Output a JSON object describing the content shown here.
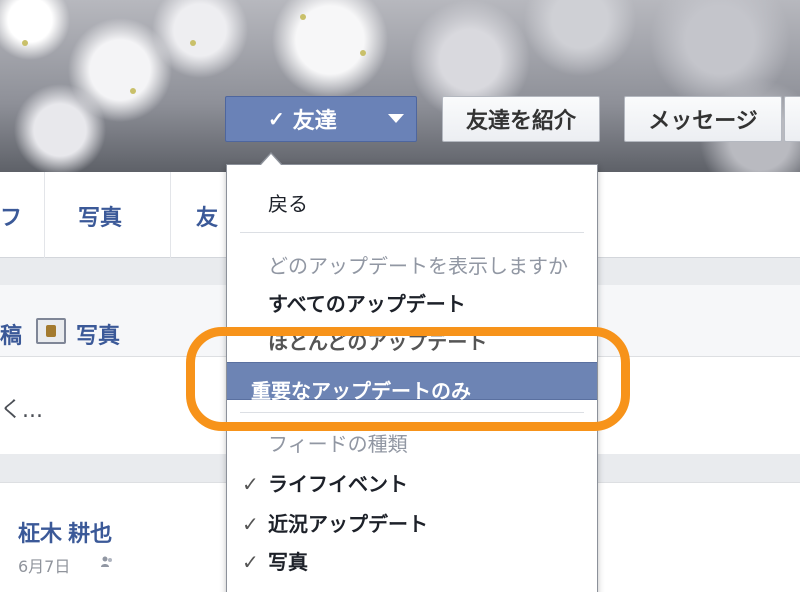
{
  "profile": {
    "friend_button": {
      "check": "✓",
      "label": "友達"
    },
    "introduce_button": "友達を紹介",
    "message_button": "メッセージ"
  },
  "nav": {
    "partial_left": "フ",
    "photos": "写真",
    "partial_friends": "友"
  },
  "composer": {
    "partial_tab": "稿",
    "photo_tab": "写真",
    "placeholder": "く..."
  },
  "post": {
    "author": "柾木 耕也",
    "date": "6月7日"
  },
  "dropdown": {
    "back": "戻る",
    "updates_header": "どのアップデートを表示しますか",
    "all_updates": "すべてのアップデート",
    "most_updates": "ほとんどのアップデート",
    "important_only": "重要なアップデートのみ",
    "feed_header": "フィードの種類",
    "life_events": "ライフイベント",
    "status_updates": "近況アップデート",
    "photos": "写真",
    "check": "✓"
  },
  "colors": {
    "facebook_blue": "#3b5998",
    "selected_bg": "#6d84b4",
    "highlight": "#f7931a"
  }
}
